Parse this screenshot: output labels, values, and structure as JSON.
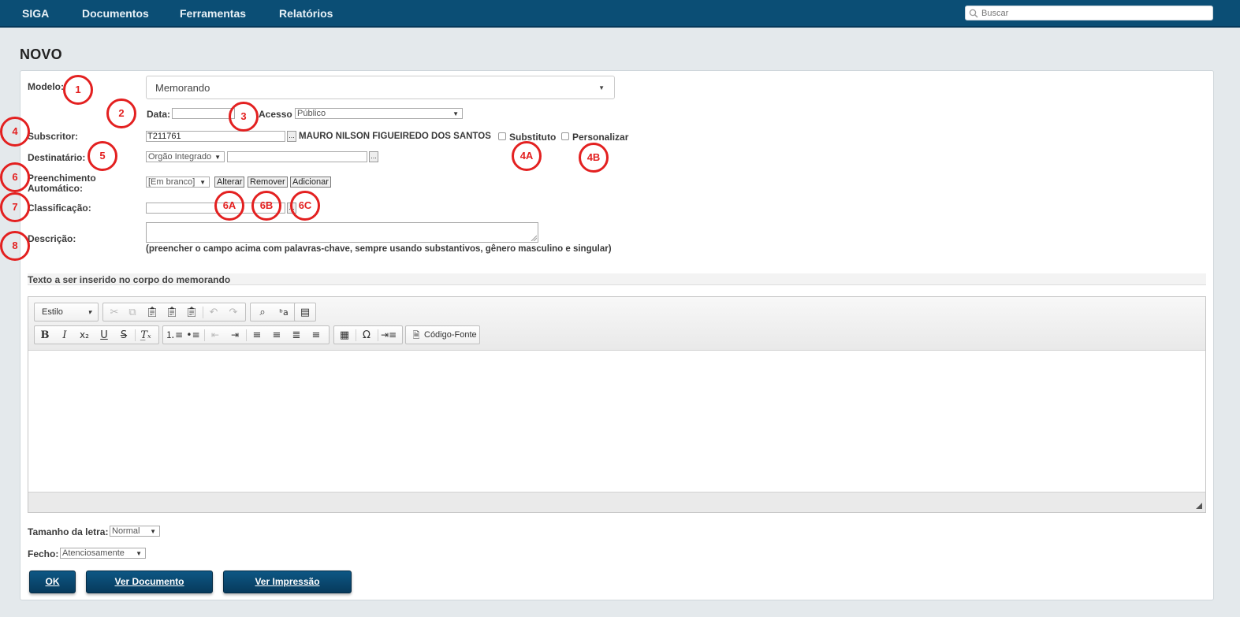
{
  "nav": {
    "items": [
      "SIGA",
      "Documentos",
      "Ferramentas",
      "Relatórios"
    ],
    "search_placeholder": "Buscar"
  },
  "page": {
    "title": "NOVO"
  },
  "form": {
    "modelo_label": "Modelo:",
    "modelo_value": "Memorando",
    "data_label": "Data:",
    "data_value": "",
    "acesso_label": "Acesso",
    "acesso_value": "Público",
    "subscritor_label": "Subscritor:",
    "subscritor_code": "T211761",
    "subscritor_name": "MAURO NILSON FIGUEIREDO DOS SANTOS",
    "substituto_label": "Substituto",
    "personalizar_label": "Personalizar",
    "destinatario_label": "Destinatário:",
    "destinatario_type": "Orgão Integrado",
    "destinatario_value": "",
    "preenchimento_label_1": "Preenchimento",
    "preenchimento_label_2": "Automático:",
    "preenchimento_value": "[Em branco]",
    "alterar_label": "Alterar",
    "remover_label": "Remover",
    "adicionar_label": "Adicionar",
    "classificacao_label": "Classificação:",
    "classificacao_value": "",
    "descricao_label": "Descrição:",
    "descricao_hint": "(preencher o campo acima com palavras-chave, sempre usando substantivos, gênero masculino e singular)"
  },
  "editor": {
    "section_title": "Texto a ser inserido no corpo do memorando",
    "style_label": "Estilo",
    "source_label": "Código-Fonte"
  },
  "bottom": {
    "tamanho_label": "Tamanho da letra:",
    "tamanho_value": "Normal",
    "fecho_label": "Fecho:",
    "fecho_value": "Atenciosamente"
  },
  "buttons": {
    "ok": "OK",
    "ver_documento": "Ver Documento",
    "ver_impressao": "Ver Impressão"
  },
  "annotations": [
    "1",
    "2",
    "3",
    "4",
    "5",
    "6",
    "7",
    "8",
    "4A",
    "4B",
    "6A",
    "6B",
    "6C"
  ],
  "colors": {
    "nav_bg": "#0b4e75",
    "button_bg": "#0a4a70",
    "annotation": "#e32020",
    "page_bg": "#e4e9ec"
  }
}
